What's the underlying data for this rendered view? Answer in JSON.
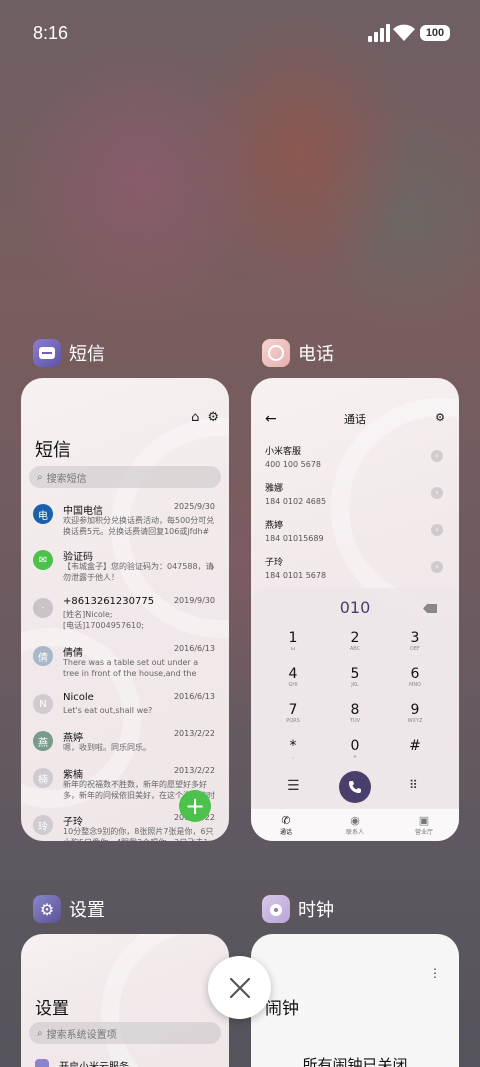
{
  "status": {
    "time": "8:16",
    "battery": "100"
  },
  "apps": {
    "sms": {
      "name": "短信",
      "more_label": "更多",
      "title": "短信",
      "search_placeholder": "搜索短信",
      "messages": [
        {
          "name": "中国电信",
          "date": "2025/9/30",
          "body": "欢迎参加积分兑换话费活动，每500分可兑换话费5元。兑换话费请回复106或jfdh#话费",
          "avatar": "电"
        },
        {
          "name": "验证码",
          "date": "",
          "body": "【韦城盒子】您的验证码为：047588，请勿泄露于他人！",
          "avatar": "✉"
        },
        {
          "name": "+8613261230775",
          "date": "2019/9/30",
          "body": "[姓名]Nicole;\n[电话]17004957610;",
          "avatar": "·"
        },
        {
          "name": "倩倩",
          "date": "2016/6/13",
          "body": "There was a table set out under a tree in front of the house,and the March Hare an…",
          "avatar": "倩"
        },
        {
          "name": "Nicole",
          "date": "2016/6/13",
          "body": "Let's eat out,shall we?",
          "avatar": "N"
        },
        {
          "name": "燕婷",
          "date": "2013/2/22",
          "body": "嗯，收到啦。同乐同乐。",
          "avatar": "燕"
        },
        {
          "name": "紫楠",
          "date": "2013/2/22",
          "body": "新年的祝福数不胜数，新年的愿望好多好多，新年的问候依旧美好，在这个温馨的时刻…",
          "avatar": "楠"
        },
        {
          "name": "子玲",
          "date": "2013/2/22",
          "body": "10分整念9别的你，8张照片7张是你，6只小狗5只像你，4眼我3个唱你，2只飞走1只…",
          "avatar": "玲"
        }
      ]
    },
    "phone": {
      "name": "电话",
      "header": "通话",
      "contacts": [
        {
          "name": "小米客服",
          "number": "400 100 5678"
        },
        {
          "name": "雅娜",
          "number": "184 0102 4685"
        },
        {
          "name": "燕婷",
          "number": "184 01015689"
        },
        {
          "name": "子玲",
          "number": "184 0101 5678"
        }
      ],
      "dialed": "010",
      "keys": [
        {
          "d": "1",
          "s": "ω"
        },
        {
          "d": "2",
          "s": "ABC"
        },
        {
          "d": "3",
          "s": "DEF"
        },
        {
          "d": "4",
          "s": "GHI"
        },
        {
          "d": "5",
          "s": "JKL"
        },
        {
          "d": "6",
          "s": "MNO"
        },
        {
          "d": "7",
          "s": "PQRS"
        },
        {
          "d": "8",
          "s": "TUV"
        },
        {
          "d": "9",
          "s": "WXYZ"
        },
        {
          "d": "*",
          "s": ","
        },
        {
          "d": "0",
          "s": "+"
        },
        {
          "d": "#",
          "s": ""
        }
      ],
      "tabs": [
        "通话",
        "联系人",
        "营业厅"
      ]
    },
    "settings": {
      "name": "设置",
      "title": "设置",
      "search_placeholder": "搜索系统设置项",
      "first_item": "开启小米云服务"
    },
    "clock": {
      "name": "时钟",
      "title": "闹钟",
      "empty": "所有闹钟已关闭"
    }
  },
  "colors": {
    "accent": "#4a3f6b",
    "fab": "#4cc24c"
  }
}
